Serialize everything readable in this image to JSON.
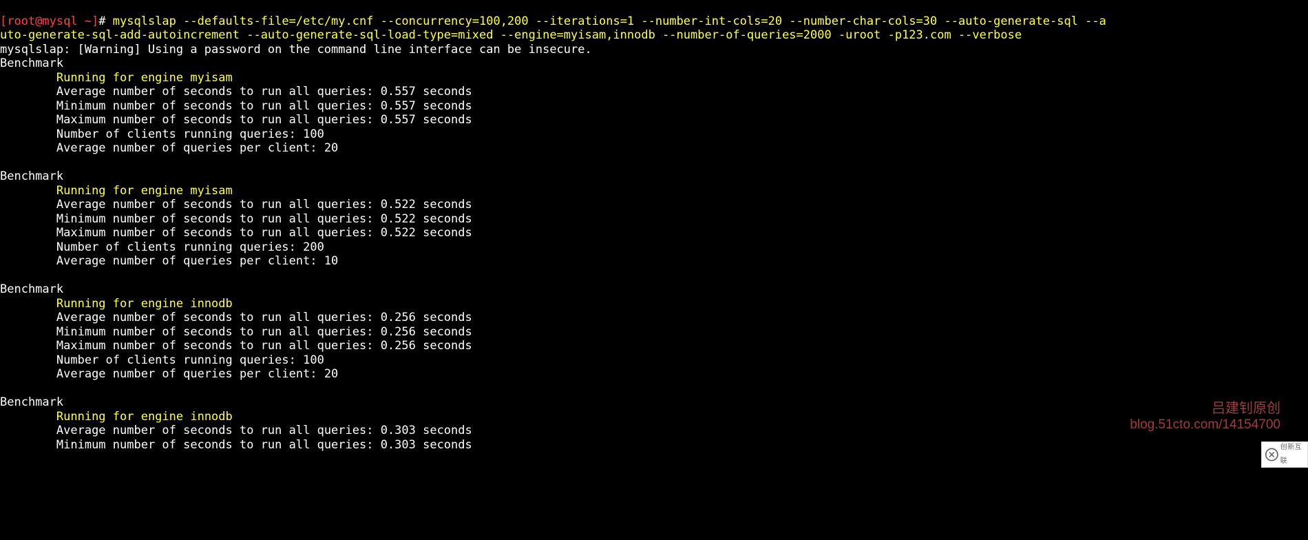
{
  "prompt": {
    "user_host": "[root@mysql ~]",
    "hash": "# "
  },
  "command": {
    "part1": "mysqlslap --defaults-file=/etc/my.cnf --concurrency=100,200 --iterations=1 --number-int-cols=20 --number-char-cols=30 --auto-generate-sql --a",
    "part2": "uto-generate-sql-add-autoincrement --auto-generate-sql-load-type=mixed --engine=myisam,innodb --number-of-queries=2000 -uroot -p123.com --verbose"
  },
  "warning": "mysqlslap: [Warning] Using a password on the command line interface can be insecure.",
  "benchmark_label": "Benchmark",
  "results": [
    {
      "engine_line": "Running for engine myisam",
      "avg": "Average number of seconds to run all queries: 0.557 seconds",
      "min": "Minimum number of seconds to run all queries: 0.557 seconds",
      "max": "Maximum number of seconds to run all queries: 0.557 seconds",
      "clients": "Number of clients running queries: 100",
      "percli": "Average number of queries per client: 20"
    },
    {
      "engine_line": "Running for engine myisam",
      "avg": "Average number of seconds to run all queries: 0.522 seconds",
      "min": "Minimum number of seconds to run all queries: 0.522 seconds",
      "max": "Maximum number of seconds to run all queries: 0.522 seconds",
      "clients": "Number of clients running queries: 200",
      "percli": "Average number of queries per client: 10"
    },
    {
      "engine_line": "Running for engine innodb",
      "avg": "Average number of seconds to run all queries: 0.256 seconds",
      "min": "Minimum number of seconds to run all queries: 0.256 seconds",
      "max": "Maximum number of seconds to run all queries: 0.256 seconds",
      "clients": "Number of clients running queries: 100",
      "percli": "Average number of queries per client: 20"
    },
    {
      "engine_line": "Running for engine innodb",
      "avg": "Average number of seconds to run all queries: 0.303 seconds",
      "min": "Minimum number of seconds to run all queries: 0.303 seconds",
      "max": "",
      "clients": "",
      "percli": ""
    }
  ],
  "pad8": "        ",
  "watermark": {
    "line1": "吕建钊原创",
    "line2": "blog.51cto.com/14154700"
  },
  "logo_text": "创新互联"
}
